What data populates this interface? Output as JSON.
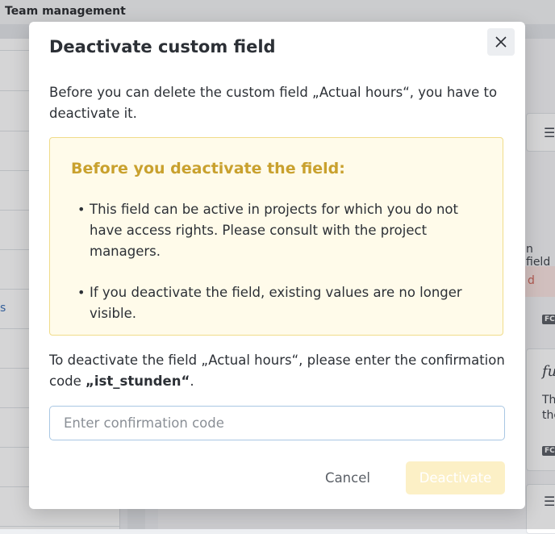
{
  "background": {
    "header_title": "Team management",
    "left_snippet": "s",
    "right_snippets": [
      "n field",
      "Th",
      "the"
    ],
    "alert_snippet": "d",
    "card_badge": "FC",
    "card_script": "fu"
  },
  "dialog": {
    "title": "Deactivate custom field",
    "close_icon": "close-icon",
    "intro": "Before you can delete the custom field „Actual hours“, you have to deactivate it.",
    "warning": {
      "title": "Before you deactivate the field:",
      "items": [
        "This field can be active in projects for which you do not have access rights. Please consult with the project managers.",
        "If you deactivate the field, existing values are no longer visible."
      ]
    },
    "confirm_prefix": "To deactivate the field „Actual hours“, please enter the confirmation code ",
    "confirm_code": "„ist_stunden“",
    "confirm_suffix": ".",
    "input": {
      "value": "",
      "placeholder": "Enter confirmation code"
    },
    "cancel_label": "Cancel",
    "deactivate_label": "Deactivate"
  },
  "colors": {
    "warning_title": "#c9a12e",
    "warning_bg": "#fffbea",
    "deactivate_disabled_bg": "#fcf0c6"
  }
}
